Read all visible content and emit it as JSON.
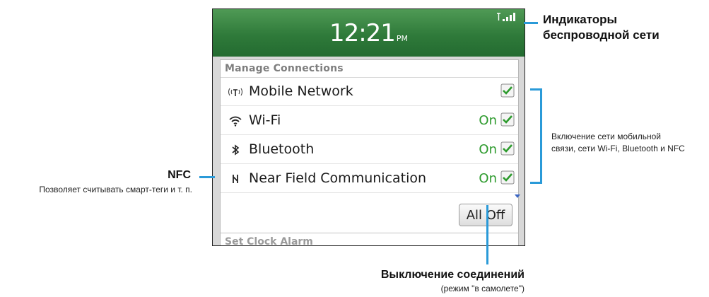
{
  "status_bar": {
    "time": "12:21",
    "ampm": "PM"
  },
  "menu": {
    "title": "Manage Connections",
    "items": [
      {
        "label": "Mobile Network",
        "state": "",
        "checked": true,
        "icon": "mobile-network-icon"
      },
      {
        "label": "Wi-Fi",
        "state": "On",
        "checked": true,
        "icon": "wifi-icon"
      },
      {
        "label": "Bluetooth",
        "state": "On",
        "checked": true,
        "icon": "bluetooth-icon"
      },
      {
        "label": "Near Field Communication",
        "state": "On",
        "checked": true,
        "icon": "nfc-icon"
      }
    ],
    "all_off": "All Off",
    "next_section": "Set Clock Alarm"
  },
  "callouts": {
    "wireless_title_1": "Индикаторы",
    "wireless_title_2": "беспроводной сети",
    "toggle_1": "Включение сети мобильной",
    "toggle_2": "связи, сети Wi-Fi, Bluetooth и NFC",
    "nfc_title": "NFC",
    "nfc_desc": "Позволяет считывать смарт-теги и т. п.",
    "off_title": "Выключение соединений",
    "off_desc": "(режим \"в самолете\")"
  },
  "colors": {
    "accent_line": "#2a9ad8",
    "header_green": "#2f7a3a",
    "on_green": "#2c9a2c"
  }
}
